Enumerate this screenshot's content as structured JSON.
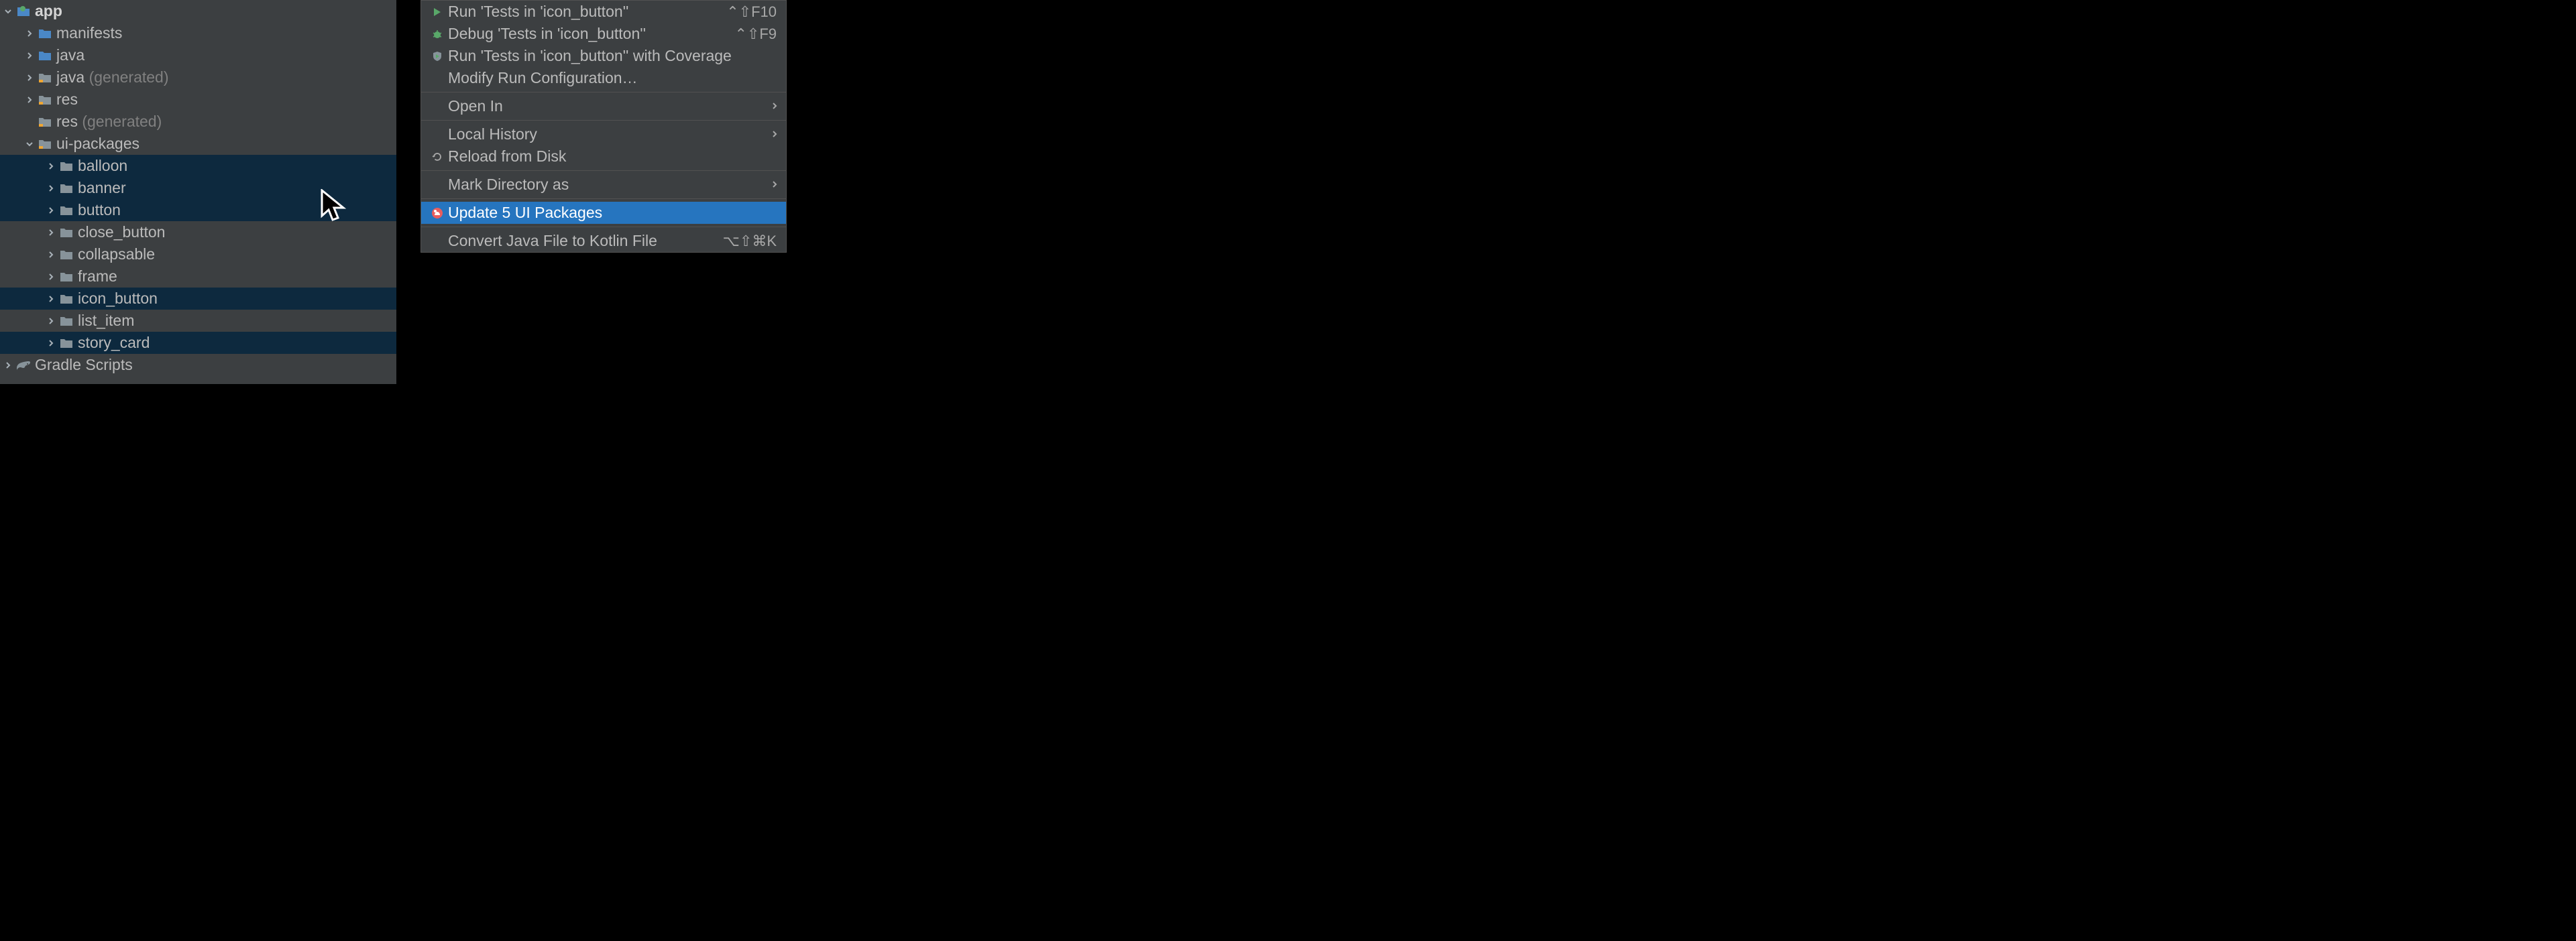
{
  "tree": {
    "app": "app",
    "manifests": "manifests",
    "java": "java",
    "java_gen_prefix": "java",
    "generated": " (generated)",
    "res": "res",
    "res_gen_prefix": "res",
    "ui_packages": "ui-packages",
    "items": [
      "balloon",
      "banner",
      "button",
      "close_button",
      "collapsable",
      "frame",
      "icon_button",
      "list_item",
      "story_card"
    ],
    "gradle": "Gradle Scripts"
  },
  "menu": {
    "run": "Run 'Tests in 'icon_button''",
    "run_sc": "⌃⇧F10",
    "debug": "Debug 'Tests in 'icon_button''",
    "debug_sc": "⌃⇧F9",
    "coverage": "Run 'Tests in 'icon_button'' with Coverage",
    "modify": "Modify Run Configuration…",
    "open_in": "Open In",
    "local_history": "Local History",
    "reload": "Reload from Disk",
    "mark_dir": "Mark Directory as",
    "update": "Update 5 UI Packages",
    "convert": "Convert Java File to Kotlin File",
    "convert_sc": "⌥⇧⌘K"
  }
}
